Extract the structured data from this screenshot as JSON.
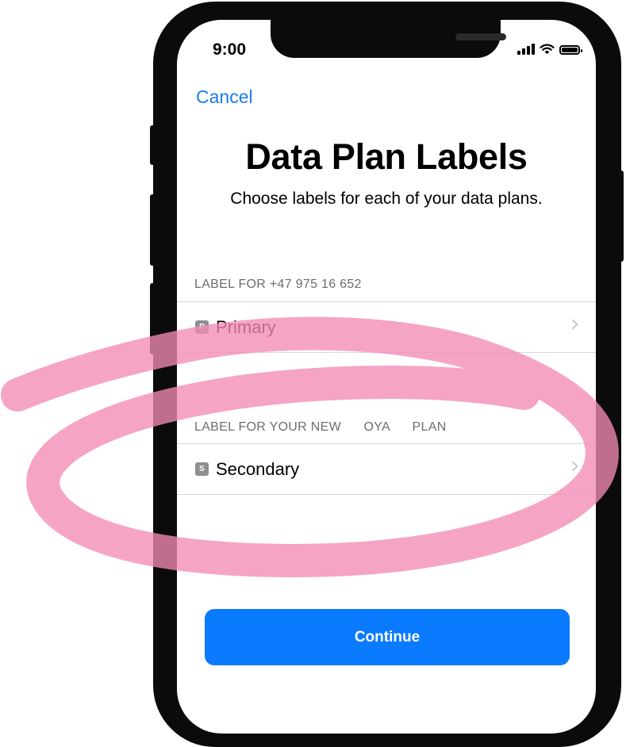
{
  "status_bar": {
    "time": "9:00"
  },
  "nav": {
    "cancel_label": "Cancel"
  },
  "header": {
    "title": "Data Plan Labels",
    "subtitle": "Choose labels for each of your data plans."
  },
  "sections": [
    {
      "header": "LABEL FOR +47 975 16 652",
      "item": {
        "badge": "P",
        "label": "Primary"
      }
    },
    {
      "header": "LABEL FOR YOUR NEW      OYA      PLAN",
      "item": {
        "badge": "S",
        "label": "Secondary"
      }
    }
  ],
  "footer": {
    "continue_label": "Continue"
  },
  "colors": {
    "accent": "#0a7aff",
    "link": "#1a7cf0",
    "annotation_pink": "#f48ab5",
    "badge_gray": "#8e8e93"
  },
  "icons": [
    "cellular-signal-icon",
    "wifi-icon",
    "battery-icon",
    "chevron-right-icon"
  ]
}
